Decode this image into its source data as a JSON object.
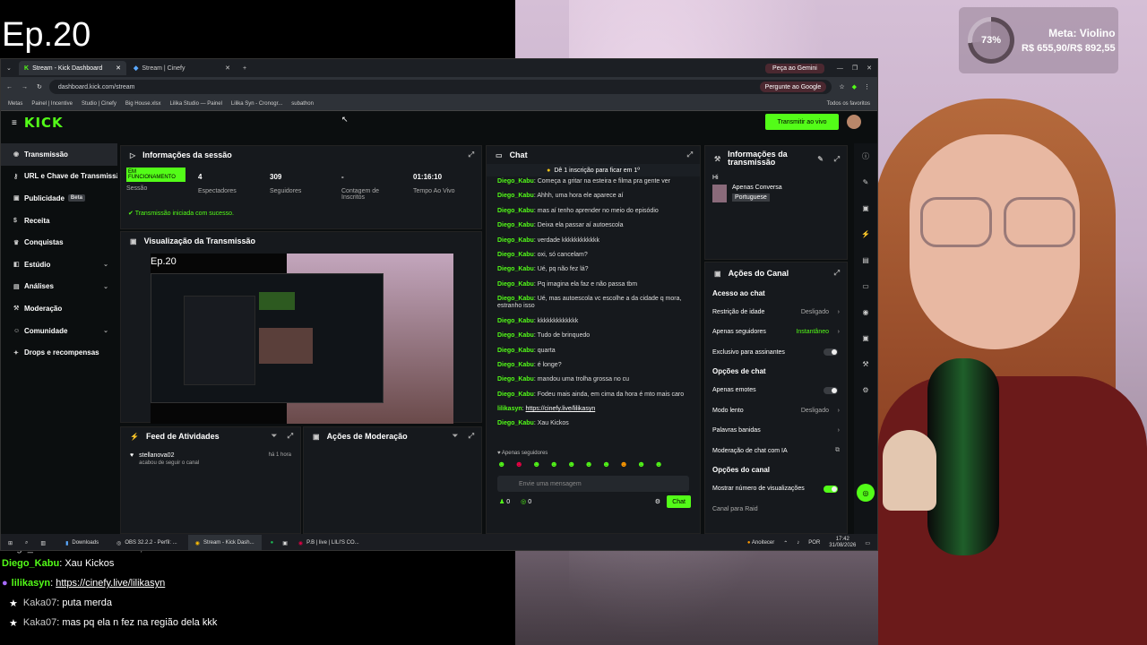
{
  "overlay": {
    "episode": "Ep.20",
    "goal": {
      "percent": "73%",
      "percent_value": 73,
      "title": "Meta: Violino",
      "amount": "R$ 655,90/R$ 892,55"
    },
    "chat": [
      {
        "type": "partial",
        "text": "Diego_Kabu: Fodeu mais ainda, em cima da hora é mto mais caro"
      },
      {
        "user": "Diego_Kabu",
        "text": "Xau Kickos"
      },
      {
        "user": "lilikasyn",
        "text": "https://cinefy.live/lilikasyn",
        "link": true
      },
      {
        "user": "Kaka07",
        "text": "puta merda"
      },
      {
        "user": "Kaka07",
        "text": "mas pq ela n fez na região dela kkk"
      }
    ]
  },
  "browser": {
    "tabs": [
      {
        "label": "Stream - Kick Dashboard",
        "active": true
      },
      {
        "label": "Stream | Cinefy",
        "active": false
      }
    ],
    "ai_tab": "Peça ao Gemini",
    "url": "dashboard.kick.com/stream",
    "ai_button": "Pergunte ao Google",
    "bookmarks": [
      "Metas",
      "Painel | Incentive",
      "Studio | Cinefy",
      "Big House.xlsx",
      "Lilika Studio — Painel",
      "Lilika Syn - Cronogr...",
      "subathon",
      "Todos os favoritos"
    ]
  },
  "kick": {
    "logo": "KICK",
    "go_live": "Transmitir ao vivo",
    "sidebar": [
      {
        "label": "Transmissão",
        "active": true
      },
      {
        "label": "URL e Chave de Transmissão"
      },
      {
        "label": "Publicidade",
        "badge": "Beta"
      },
      {
        "label": "Receita"
      },
      {
        "label": "Conquistas"
      },
      {
        "label": "Estúdio",
        "chev": "⌄"
      },
      {
        "label": "Análises",
        "chev": "⌄"
      },
      {
        "label": "Moderação"
      },
      {
        "label": "Comunidade",
        "chev": "⌄"
      },
      {
        "label": "Drops e recompensas"
      }
    ],
    "session": {
      "title": "Informações da sessão",
      "status": "EM FUNCIONAMENTO",
      "status_label": "Sessão",
      "stats": [
        {
          "value": "4",
          "label": "Espectadores"
        },
        {
          "value": "309",
          "label": "Seguidores"
        },
        {
          "value": "-",
          "label": "Contagem de Inscritos"
        },
        {
          "value": "01:16:10",
          "label": "Tempo Ao Vivo"
        }
      ],
      "success": "Transmissão iniciada com sucesso."
    },
    "preview": {
      "title": "Visualização da Transmissão",
      "episode": "Ep.20"
    },
    "activity": {
      "title": "Feed de Atividades",
      "user": "stellanova02",
      "action": "acabou de seguir o canal",
      "time": "há 1 hora"
    },
    "moderation": {
      "title": "Ações de Moderação"
    },
    "chat": {
      "title": "Chat",
      "banner": "Dê 1 inscrição para ficar em 1º",
      "messages": [
        {
          "user": "Diego_Kabu",
          "text": "Começa a gritar na esteira e filma pra gente ver"
        },
        {
          "user": "Diego_Kabu",
          "text": "Ahhh, uma hora ele aparece aí"
        },
        {
          "user": "Diego_Kabu",
          "text": "mas aí tenho aprender no meio do episódio"
        },
        {
          "user": "Diego_Kabu",
          "text": "Deixa ela passar aí autoescola"
        },
        {
          "user": "Diego_Kabu",
          "text": "verdade kkkkkkkkkkkk"
        },
        {
          "user": "Diego_Kabu",
          "text": "oxi, só cancelam?"
        },
        {
          "user": "Diego_Kabu",
          "text": "Ué, pq não fez lá?"
        },
        {
          "user": "Diego_Kabu",
          "text": "Pq imagina ela faz e não passa tbm"
        },
        {
          "user": "Diego_Kabu",
          "text": "Ué, mas autoescola vc escolhe a da cidade q mora, estranho isso"
        },
        {
          "user": "Diego_Kabu",
          "text": "kkkkkkkkkkkkk"
        },
        {
          "user": "Diego_Kabu",
          "text": "Tudo de brinquedo"
        },
        {
          "user": "Diego_Kabu",
          "text": "quarta"
        },
        {
          "user": "Diego_Kabu",
          "text": "é longe?"
        },
        {
          "user": "Diego_Kabu",
          "text": "mandou uma trolha grossa no cu"
        },
        {
          "user": "Diego_Kabu",
          "text": "Fodeu mais ainda, em cima da hora é mto mais caro"
        },
        {
          "user": "lilikasyn",
          "text": "https://cinefy.live/lilikasyn",
          "link": true
        },
        {
          "user": "Diego_Kabu",
          "text": "Xau Kickos"
        }
      ],
      "followers_only": "Apenas seguidores",
      "placeholder": "Envie uma mensagem",
      "counts": [
        "0",
        "0"
      ],
      "send": "Chat"
    },
    "stream_info": {
      "title": "Informações da transmissão",
      "greeting": "Hi",
      "category": "Apenas Conversa",
      "language": "Portuguese"
    },
    "channel_actions": {
      "title": "Ações do Canal",
      "sections": [
        {
          "heading": "Acesso ao chat",
          "rows": [
            {
              "label": "Restrição de idade",
              "value": "Desligado",
              "arrow": true
            },
            {
              "label": "Apenas seguidores",
              "value": "Instantâneo",
              "on": true,
              "arrow": true
            },
            {
              "label": "Exclusivo para assinantes",
              "toggle": false
            }
          ]
        },
        {
          "heading": "Opções de chat",
          "rows": [
            {
              "label": "Apenas emotes",
              "toggle": false
            },
            {
              "label": "Modo lento",
              "value": "Desligado",
              "arrow": true
            },
            {
              "label": "Palavras banidas",
              "arrow": true
            },
            {
              "label": "Moderação de chat com IA",
              "ext": true
            }
          ]
        },
        {
          "heading": "Opções do canal",
          "rows": [
            {
              "label": "Mostrar número de visualizações",
              "toggle": true
            },
            {
              "label": "Canal para Raid"
            }
          ]
        }
      ]
    }
  },
  "taskbar": {
    "apps": [
      "Downloads",
      "OBS 32.2.2 - Perfil: ...",
      "Stream - Kick Dash...",
      "P.B | live | LILI'S CO..."
    ],
    "weather": "Anoitecer",
    "lang": "POR",
    "time": "17:42",
    "date": "31/08/2026"
  },
  "colors": {
    "kick_green": "#53fc18",
    "panel": "#16191d",
    "bg": "#0b0e0f"
  }
}
